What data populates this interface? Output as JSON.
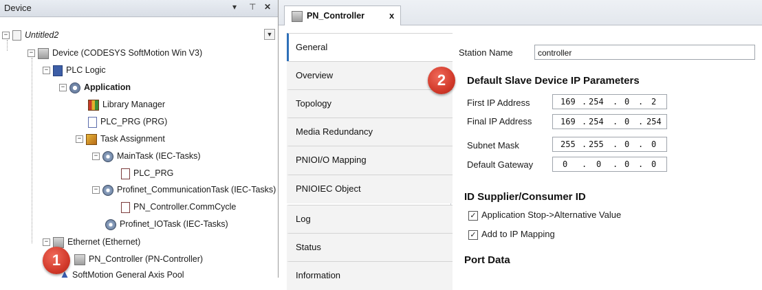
{
  "device_pane": {
    "title": "Device",
    "header_buttons": [
      "▾",
      "⊤",
      "✕"
    ],
    "tree": [
      {
        "id": "untitled",
        "label": "Untitled2",
        "expander": "−",
        "icon": "project-icon"
      },
      {
        "id": "device",
        "label": "Device (CODESYS SoftMotion Win V3)",
        "expander": "−",
        "icon": "device-icon"
      },
      {
        "id": "plc-logic",
        "label": "PLC Logic",
        "expander": "−",
        "icon": "plc-logic-icon"
      },
      {
        "id": "application",
        "label": "Application",
        "expander": "−",
        "icon": "application-icon"
      },
      {
        "id": "library-manager",
        "label": "Library Manager",
        "icon": "library-icon"
      },
      {
        "id": "plc-prg",
        "label": "PLC_PRG (PRG)",
        "icon": "program-icon"
      },
      {
        "id": "task-assignment",
        "label": "Task Assignment",
        "expander": "−",
        "icon": "task-config-icon"
      },
      {
        "id": "maintask",
        "label": "MainTask (IEC-Tasks)",
        "expander": "−",
        "icon": "task-icon"
      },
      {
        "id": "maintask-call",
        "label": "PLC_PRG",
        "icon": "program-call-icon"
      },
      {
        "id": "comm-task",
        "label": "Profinet_CommunicationTask (IEC-Tasks)",
        "expander": "−",
        "icon": "task-icon"
      },
      {
        "id": "commcycle",
        "label": "PN_Controller.CommCycle",
        "icon": "program-call-icon"
      },
      {
        "id": "io-task",
        "label": "Profinet_IOTask (IEC-Tasks)",
        "icon": "task-icon"
      },
      {
        "id": "ethernet",
        "label": "Ethernet (Ethernet)",
        "expander": "−",
        "icon": "ethernet-icon"
      },
      {
        "id": "pn-controller",
        "label": "PN_Controller (PN-Controller)",
        "icon": "pn-controller-icon"
      },
      {
        "id": "axis-pool",
        "label": "SoftMotion General Axis Pool",
        "icon": "axis-pool-icon"
      }
    ]
  },
  "editor": {
    "tab_label": "PN_Controller",
    "tab_close": "x",
    "side_tabs": [
      "General",
      "Overview",
      "Topology",
      "Media Redundancy",
      "PNIOI/O Mapping",
      "PNIOIEC Object",
      "Log",
      "Status",
      "Information"
    ],
    "active_tab": "General",
    "station_name_label": "Station Name",
    "station_name_value": "controller",
    "ip_section_title": "Default Slave Device IP Parameters",
    "ip_rows": [
      {
        "label": "First IP Address",
        "octets": [
          "169",
          "254",
          "0",
          "2"
        ]
      },
      {
        "label": "Final IP Address",
        "octets": [
          "169",
          "254",
          "0",
          "254"
        ]
      },
      {
        "label": "Subnet Mask",
        "octets": [
          "255",
          "255",
          "0",
          "0"
        ]
      },
      {
        "label": "Default Gateway",
        "octets": [
          "0",
          "0",
          "0",
          "0"
        ]
      }
    ],
    "id_section_title": "ID Supplier/Consumer ID",
    "checkboxes": [
      {
        "label": "Application Stop->Alternative Value",
        "checked": true
      },
      {
        "label": "Add to IP Mapping",
        "checked": true
      }
    ],
    "port_section_title": "Port Data"
  },
  "callouts": {
    "one": "1",
    "two": "2"
  },
  "colors": {
    "callout": "#d23a2b",
    "active_tab_accent": "#2d6fb8"
  }
}
